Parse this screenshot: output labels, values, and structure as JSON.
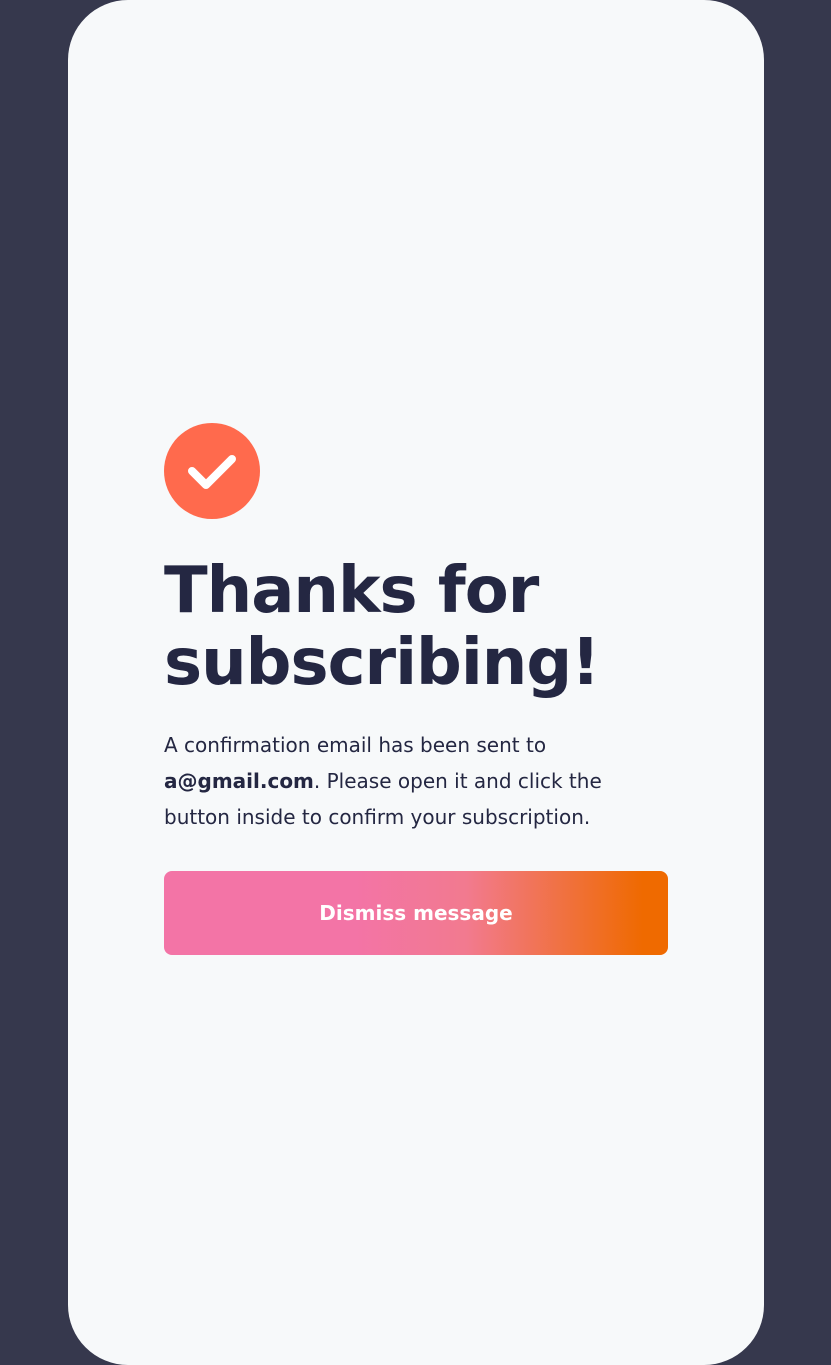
{
  "colors": {
    "page_background": "#36384d",
    "card_background": "#f7f9fa",
    "heading_text": "#242742",
    "accent": "#ff6a4d",
    "button_gradient_start": "#f374a6",
    "button_gradient_mid": "#f27a8f",
    "button_gradient_end": "#ef6a00"
  },
  "success_icon": {
    "icon": "check-icon"
  },
  "heading": "Thanks for subscribing!",
  "message": {
    "prefix": "A confirmation email has been sent to ",
    "email": "a@gmail.com",
    "suffix": ". Please open it and click the button inside to confirm your subscription."
  },
  "dismiss_button": {
    "label": "Dismiss message"
  }
}
